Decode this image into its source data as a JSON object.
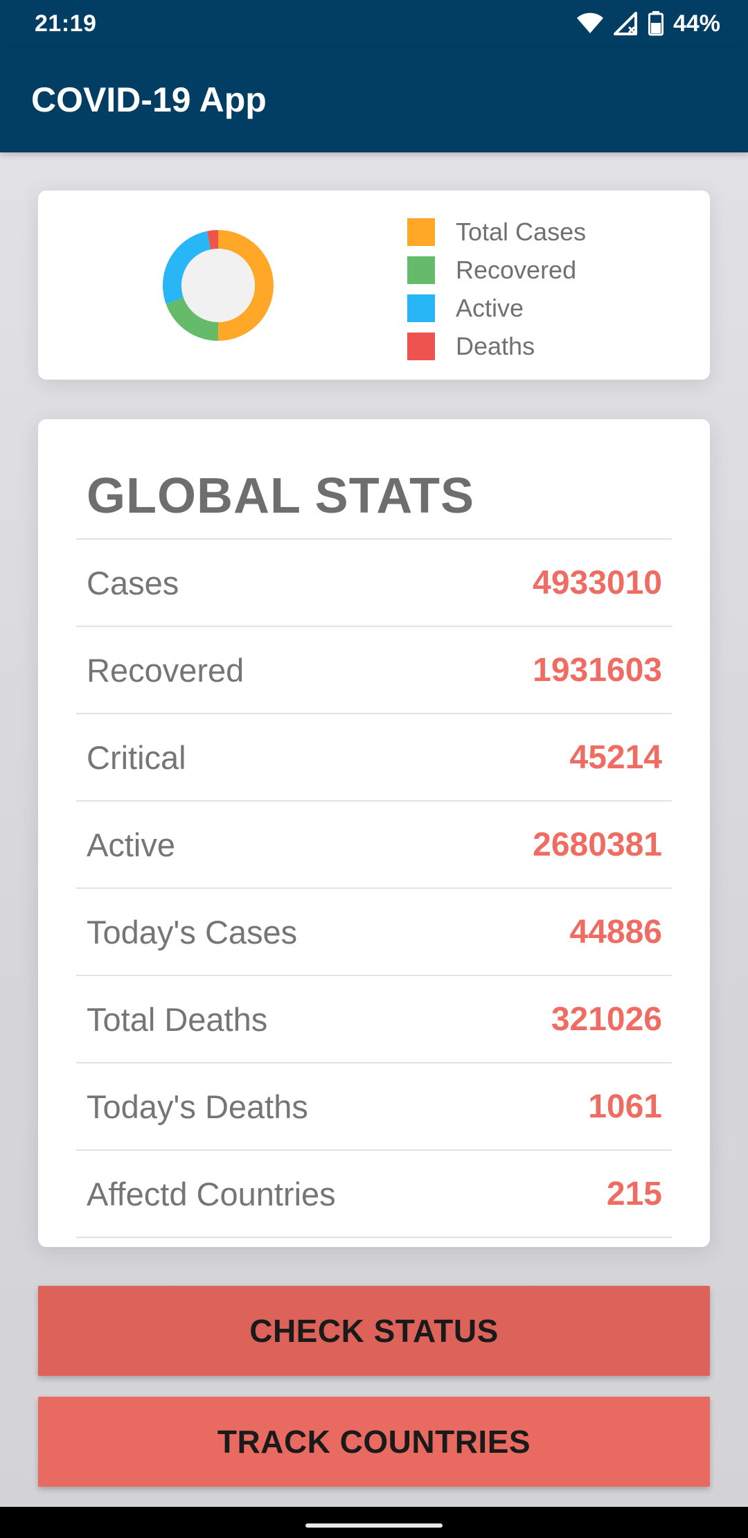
{
  "status_bar": {
    "time": "21:19",
    "battery_percent": "44%",
    "icons": [
      "wifi-icon",
      "signal-icon",
      "battery-icon"
    ]
  },
  "app_bar": {
    "title": "COVID-19 App"
  },
  "chart_data": {
    "type": "pie",
    "donut": true,
    "legend_placement": "right",
    "labels": [
      "Total Cases",
      "Recovered",
      "Active",
      "Deaths"
    ],
    "values": [
      4933010,
      1931603,
      2680381,
      321026
    ],
    "colors": [
      "#ffa726",
      "#66bb6a",
      "#29b6f6",
      "#ef5350"
    ],
    "legend": [
      {
        "label": "Total Cases",
        "color": "#ffa726"
      },
      {
        "label": "Recovered",
        "color": "#66bb6a"
      },
      {
        "label": "Active",
        "color": "#29b6f6"
      },
      {
        "label": "Deaths",
        "color": "#ef5350"
      }
    ]
  },
  "global_stats": {
    "title": "GLOBAL STATS",
    "rows": [
      {
        "label": "Cases",
        "value": "4933010"
      },
      {
        "label": "Recovered",
        "value": "1931603"
      },
      {
        "label": "Critical",
        "value": "45214"
      },
      {
        "label": "Active",
        "value": "2680381"
      },
      {
        "label": "Today's Cases",
        "value": "44886"
      },
      {
        "label": "Total Deaths",
        "value": "321026"
      },
      {
        "label": "Today's Deaths",
        "value": "1061"
      },
      {
        "label": "Affectd Countries",
        "value": "215"
      }
    ]
  },
  "buttons": {
    "check_status": "CHECK STATUS",
    "track_countries": "TRACK COUNTRIES"
  },
  "colors": {
    "primary": "#023e63",
    "accent_value": "#ef6c62",
    "button_bg": "#e0645b"
  }
}
